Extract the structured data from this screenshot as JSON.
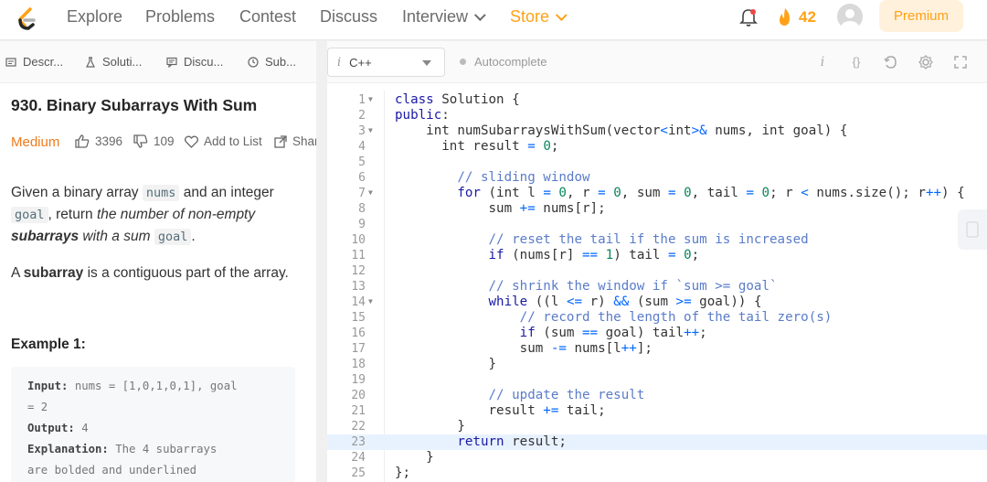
{
  "nav": {
    "links": [
      "Explore",
      "Problems",
      "Contest",
      "Discuss",
      "Interview",
      "Store"
    ],
    "streak_count": "42",
    "premium_label": "Premium",
    "accent": "#ffa116"
  },
  "left_tabs": [
    "Descr...",
    "Soluti...",
    "Discu...",
    "Sub..."
  ],
  "problem": {
    "title": "930. Binary Subarrays With Sum",
    "difficulty": "Medium",
    "likes": "3396",
    "dislikes": "109",
    "add_to_list": "Add to List",
    "share": "Share",
    "desc_1": "Given a binary array ",
    "code_nums": "nums",
    "desc_2": " and an integer",
    "code_goal": "goal",
    "desc_3": ", return ",
    "desc_italic_1": "the number of non-empty",
    "desc_bold": "subarrays",
    "desc_italic_2": " with a sum ",
    "code_goal2": "goal",
    "desc_4": ".",
    "def_1": "A ",
    "def_bold": "subarray",
    "def_2": " is a contiguous part of the array.",
    "example_title": "Example 1:",
    "ex_input_label": "Input:",
    "ex_input_value": " nums = [1,0,1,0,1], goal",
    "ex_input_value2": "= 2",
    "ex_output_label": "Output:",
    "ex_output_value": " 4",
    "ex_explain_label": "Explanation:",
    "ex_explain_value": " The 4 subarrays",
    "ex_explain_value2": "are bolded and underlined"
  },
  "editor": {
    "language": "C++",
    "autocomplete_label": "Autocomplete"
  }
}
